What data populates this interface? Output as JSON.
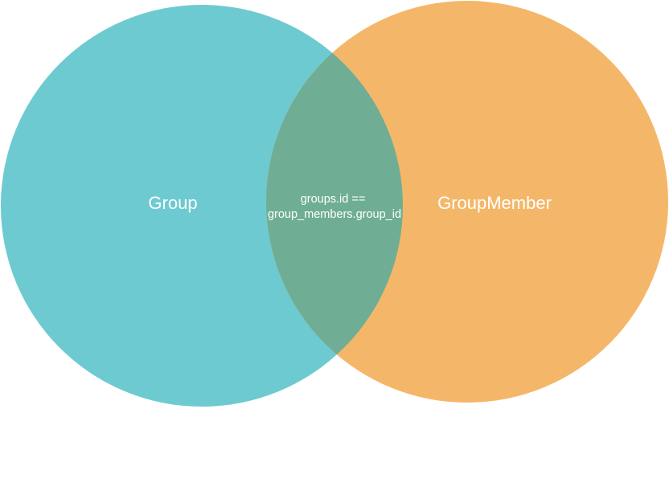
{
  "diagram": {
    "type": "venn",
    "sets": [
      {
        "label": "Group",
        "color": "#6ecad1"
      },
      {
        "label": "GroupMember",
        "color": "#f4b769"
      }
    ],
    "intersection": {
      "color": "#6fae94",
      "label_lines": [
        "groups.id ==",
        "group_members.group_id"
      ]
    }
  }
}
